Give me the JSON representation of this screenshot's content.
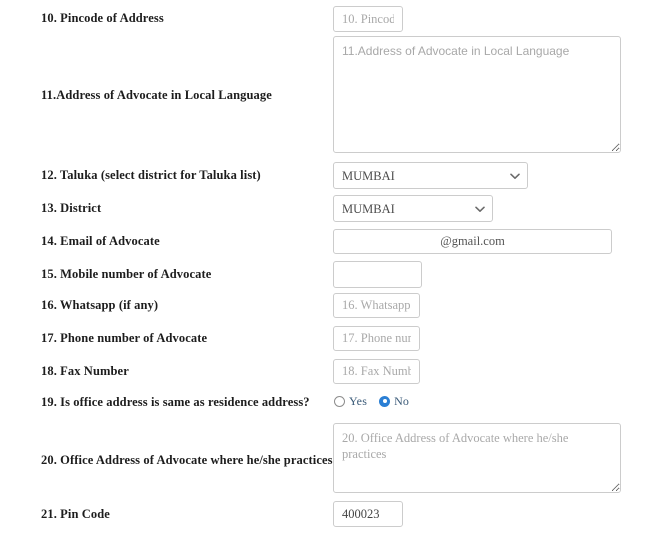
{
  "form": {
    "fields": [
      {
        "id": "pincode-of-address",
        "number": "10.",
        "label": "10. Pincode of Address",
        "control": "text",
        "value": "",
        "placeholder": "10. Pincod"
      },
      {
        "id": "address-of-advocate-in-local-language",
        "number": "11.",
        "label": "11.Address of Advocate in Local Language",
        "control": "textarea",
        "value": "",
        "placeholder": "11.Address of Advocate in Local Language"
      },
      {
        "id": "taluka",
        "number": "12.",
        "label": "12. Taluka (select district for Taluka list)",
        "control": "select",
        "value": "MUMBAI",
        "options": [
          "MUMBAI"
        ]
      },
      {
        "id": "district",
        "number": "13.",
        "label": "13. District",
        "control": "select",
        "value": "MUMBAI",
        "options": [
          "MUMBAI"
        ]
      },
      {
        "id": "email-of-advocate",
        "number": "14.",
        "label": "14. Email of Advocate",
        "control": "text",
        "value": "@gmail.com",
        "placeholder": ""
      },
      {
        "id": "mobile-number-of-advocate",
        "number": "15.",
        "label": "15. Mobile number of Advocate",
        "control": "text",
        "value": "",
        "placeholder": ""
      },
      {
        "id": "whatsapp",
        "number": "16.",
        "label": "16. Whatsapp (if any)",
        "control": "text",
        "value": "",
        "placeholder": "16. Whatsapp ("
      },
      {
        "id": "phone-number-of-advocate",
        "number": "17.",
        "label": "17. Phone number of Advocate",
        "control": "text",
        "value": "",
        "placeholder": "17. Phone num"
      },
      {
        "id": "fax-number",
        "number": "18.",
        "label": "18. Fax Number",
        "control": "text",
        "value": "",
        "placeholder": "18. Fax Numbe"
      },
      {
        "id": "office-same-as-residence",
        "number": "19.",
        "label": "19. Is office address is same as residence address?",
        "control": "radio",
        "options": [
          {
            "label": "Yes",
            "checked": false
          },
          {
            "label": "No",
            "checked": true
          }
        ]
      },
      {
        "id": "office-address-of-advocate",
        "number": "20.",
        "label": "20. Office Address of Advocate where he/she practices",
        "control": "textarea",
        "value": "",
        "placeholder": "20. Office Address of Advocate where he/she practices"
      },
      {
        "id": "pin-code",
        "number": "21.",
        "label": "21. Pin Code",
        "control": "text",
        "value": "400023",
        "placeholder": ""
      }
    ]
  },
  "colors": {
    "page_background": "#ffffff",
    "label_text": "#1d1d1d",
    "input_border": "#cccccc",
    "placeholder_text": "#a9a9a9",
    "value_text": "#555555",
    "radio_selected": "#2b7fd4",
    "radio_label_text": "#3a5a78"
  },
  "icons": {
    "chevron_down": "chevron-down-icon",
    "resize_grip": "resize-grip-icon"
  }
}
